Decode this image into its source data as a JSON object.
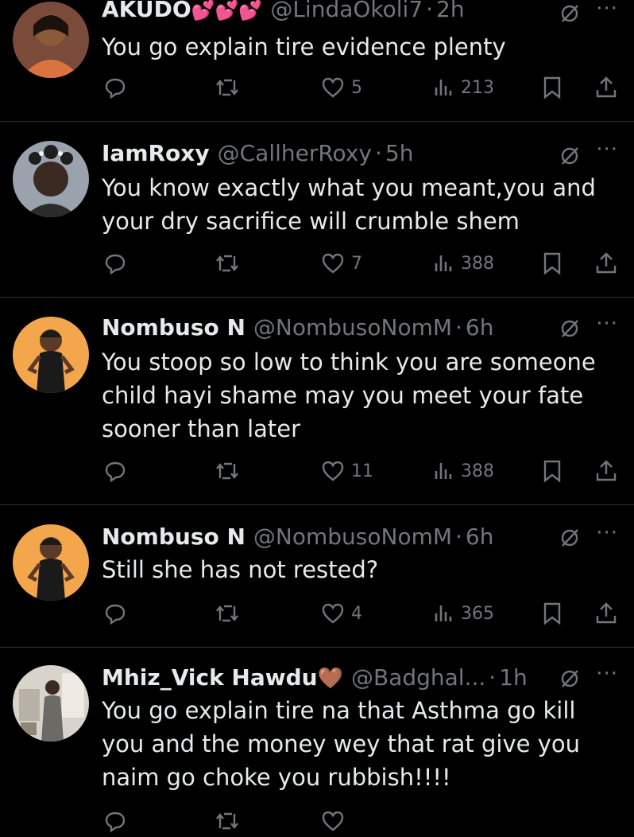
{
  "tweets": [
    {
      "name": "AKUDO",
      "emoji": "💕💕💕",
      "handle": "@LindaOkoli7",
      "time": "2h",
      "text_lines": [
        "You go explain tire evidence plenty"
      ],
      "likes": "5",
      "views": "213",
      "avatar_colors": [
        "#c8613f",
        "#d9743f"
      ]
    },
    {
      "name": "IamRoxy",
      "emoji": "",
      "handle": "@CallherRoxy",
      "time": "5h",
      "text_lines": [
        "You know exactly what you meant,you and",
        "your dry sacrifice will crumble shem"
      ],
      "likes": "7",
      "views": "388",
      "avatar_colors": [
        "#9aa3ad",
        "#2b2b2b"
      ]
    },
    {
      "name": "Nombuso N",
      "emoji": "",
      "handle": "@NombusoNomM",
      "time": "6h",
      "text_lines": [
        "You stoop so low to think you are someone",
        "child hayi shame may you meet your fate",
        "sooner than later"
      ],
      "likes": "11",
      "views": "388",
      "avatar_colors": [
        "#f4a64c",
        "#1a1a1a"
      ]
    },
    {
      "name": "Nombuso N",
      "emoji": "",
      "handle": "@NombusoNomM",
      "time": "6h",
      "text_lines": [
        "Still she has not rested?"
      ],
      "likes": "4",
      "views": "365",
      "avatar_colors": [
        "#f4a64c",
        "#1a1a1a"
      ]
    },
    {
      "name": "Mhiz_Vick Hawdu",
      "emoji": "🤎",
      "handle": "@Badghal...",
      "time": "1h",
      "text_lines": [
        "You go explain tire na that Asthma go kill",
        "you and the money wey that rat give you",
        "naim go choke you rubbish!!!!"
      ],
      "likes": "",
      "views": "",
      "avatar_colors": [
        "#d8d4cc",
        "#6b6a66"
      ]
    }
  ],
  "separator": "·",
  "more_label": "···"
}
